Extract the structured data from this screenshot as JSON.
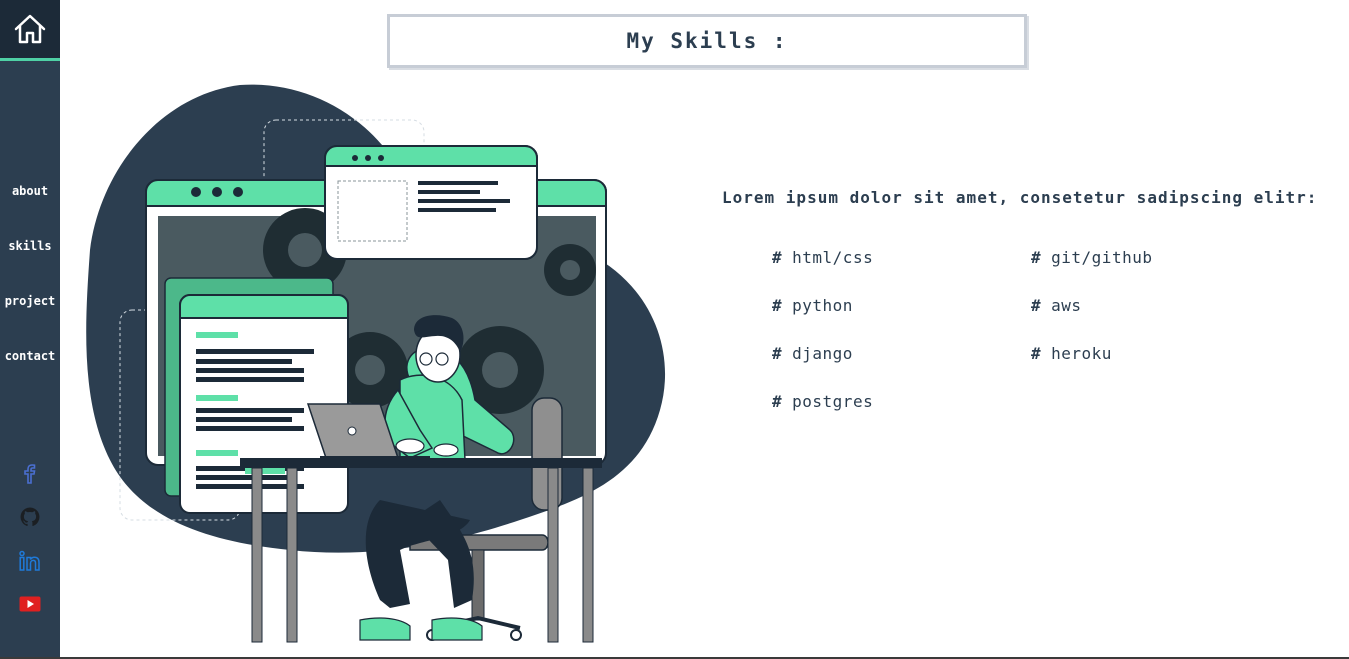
{
  "sidebar": {
    "home_icon": "home-icon",
    "nav": [
      {
        "label": "about"
      },
      {
        "label": "skills"
      },
      {
        "label": "project"
      },
      {
        "label": "contact"
      }
    ],
    "social": [
      {
        "icon": "facebook-icon",
        "color": "#4a6fd1"
      },
      {
        "icon": "github-icon",
        "color": "#1b1f23"
      },
      {
        "icon": "linkedin-icon",
        "color": "#1f7ad9"
      },
      {
        "icon": "youtube-icon",
        "color": "#e02020"
      }
    ]
  },
  "header": {
    "title": "My Skills :"
  },
  "skills": {
    "intro": "Lorem ipsum dolor sit amet, consetetur sadipscing elitr:",
    "hash_symbol": "#",
    "left_column": [
      "html/css",
      "python",
      "django",
      "postgres"
    ],
    "right_column": [
      "git/github",
      "aws",
      "heroku"
    ]
  },
  "colors": {
    "sidebar_bg": "#2c3e50",
    "accent": "#4fd1a5",
    "text": "#2c3e50"
  }
}
